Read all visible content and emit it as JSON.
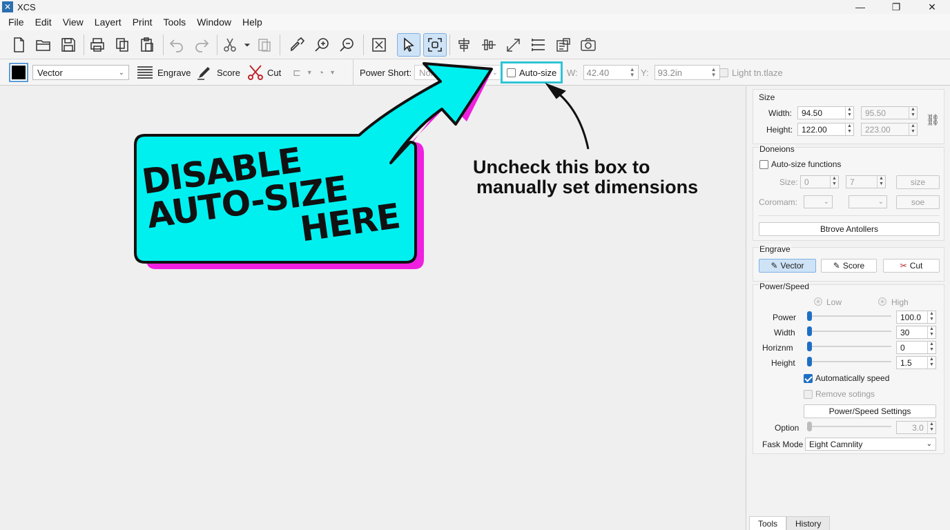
{
  "window": {
    "title": "XCS",
    "controls": {
      "minimize": "—",
      "maximize": "❐",
      "close": "✕"
    }
  },
  "menu": [
    "File",
    "Edit",
    "View",
    "Layert",
    "Print",
    "Tools",
    "Window",
    "Help"
  ],
  "toolbar1": {
    "icons": [
      "new-file-icon",
      "open-folder-icon",
      "save-icon",
      "print-icon",
      "copy-icon",
      "paste-icon",
      "undo-icon",
      "redo-icon",
      "cut-scissors-icon",
      "cut-dropdown-icon",
      "clipboard-icon",
      "eyedropper-icon",
      "zoom-in-icon",
      "zoom-out-icon",
      "fit-frame-icon",
      "select-pointer-icon",
      "bounding-select-icon",
      "align-center-h-icon",
      "align-center-v-icon",
      "arrow-scale-icon",
      "distribute-icon",
      "export-icon",
      "camera-icon"
    ]
  },
  "toolbar2": {
    "mode_value": "Vector",
    "engrave_label": "Engrave",
    "score_label": "Score",
    "cut_label": "Cut",
    "power_short_label": "Power Short:",
    "power_short_value": "Non",
    "autosize_label": "Auto-size",
    "w_label": "W:",
    "w_value": "42.40",
    "y_label": "Y:",
    "y_value": "93.2in",
    "light_label": "Light tn.tlaze"
  },
  "annotation": {
    "banner": [
      "DISABLE",
      "AUTO-SIZE",
      "HERE"
    ],
    "callout": [
      "Uncheck this box to",
      "manually set dimensions"
    ],
    "colors": {
      "banner_fill": "#00f0f0",
      "banner_shadow": "#f020e0",
      "highlight": "#2ec4d6"
    }
  },
  "panel": {
    "size": {
      "title": "Size",
      "width_label": "Width:",
      "width_value": "94.50",
      "width_value2": "95.50",
      "height_label": "Height:",
      "height_value": "122.00",
      "height_value2": "223.00"
    },
    "doneions": {
      "title": "Doneions",
      "autosize_functions_label": "Auto-size functions",
      "size_label": "Size:",
      "size_value1": "0",
      "size_value2": "7",
      "size_button": "size",
      "coromam_label": "Coromam:",
      "soe_button": "soe",
      "btrove_button": "Btrove Antollers"
    },
    "engrave": {
      "title": "Engrave",
      "vector": "Vector",
      "score": "Score",
      "cut": "Cut"
    },
    "power_speed": {
      "title": "Power/Speed",
      "low": "Low",
      "high": "High",
      "power_label": "Power",
      "power_value": "100.0",
      "width_label": "Width",
      "width_value": "30",
      "horizon_label": "Horiznm",
      "horizon_value": "0",
      "height_label": "Height",
      "height_value": "1.5",
      "auto_speed_label": "Automatically speed",
      "remove_label": "Remove sotings",
      "settings_button": "Power/Speed Settings",
      "option_label": "Option",
      "option_value": "3.0",
      "fask_label": "Fask Mode",
      "fask_value": "Eight Camnlity"
    },
    "tabs": [
      "Tools",
      "History"
    ]
  }
}
